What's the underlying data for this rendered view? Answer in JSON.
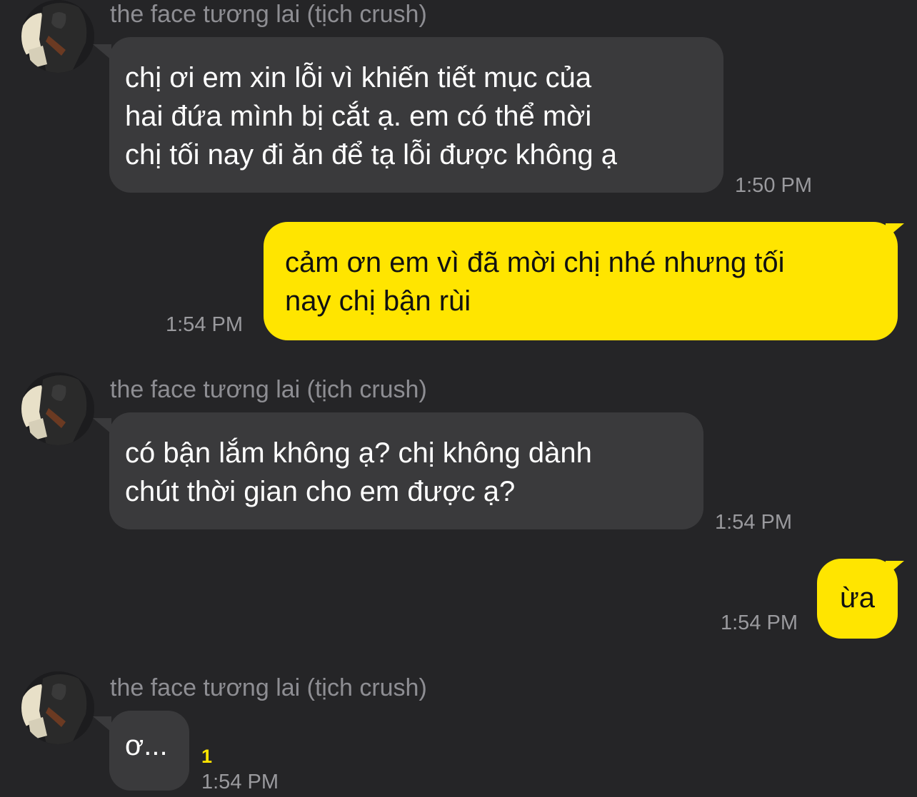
{
  "contact": {
    "name": "the face tương lai (tịch crush)"
  },
  "messages": [
    {
      "direction": "incoming",
      "lines": [
        "chị ơi em xin lỗi vì khiến tiết mục của",
        "hai đứa mình bị cắt ạ. em có thể mời",
        "chị tối nay đi ăn để tạ lỗi được không ạ"
      ],
      "time": "1:50 PM"
    },
    {
      "direction": "outgoing",
      "lines": [
        "cảm ơn em vì đã mời chị nhé nhưng tối",
        "nay chị bận rùi"
      ],
      "time": "1:54 PM"
    },
    {
      "direction": "incoming",
      "lines": [
        "có bận lắm không ạ? chị không dành",
        "chút thời gian cho em được ạ?"
      ],
      "time": "1:54 PM"
    },
    {
      "direction": "outgoing",
      "lines": [
        "ừa"
      ],
      "time": "1:54 PM"
    },
    {
      "direction": "incoming",
      "lines": [
        "ơ..."
      ],
      "time": "1:54 PM",
      "unread_count": "1"
    }
  ],
  "colors": {
    "background": "#252527",
    "incoming_bubble": "#3a3a3c",
    "outgoing_bubble": "#ffe500",
    "timestamp": "#9a9a9e",
    "unread": "#ffe500"
  },
  "icons": {
    "avatar": "profile-photo"
  }
}
